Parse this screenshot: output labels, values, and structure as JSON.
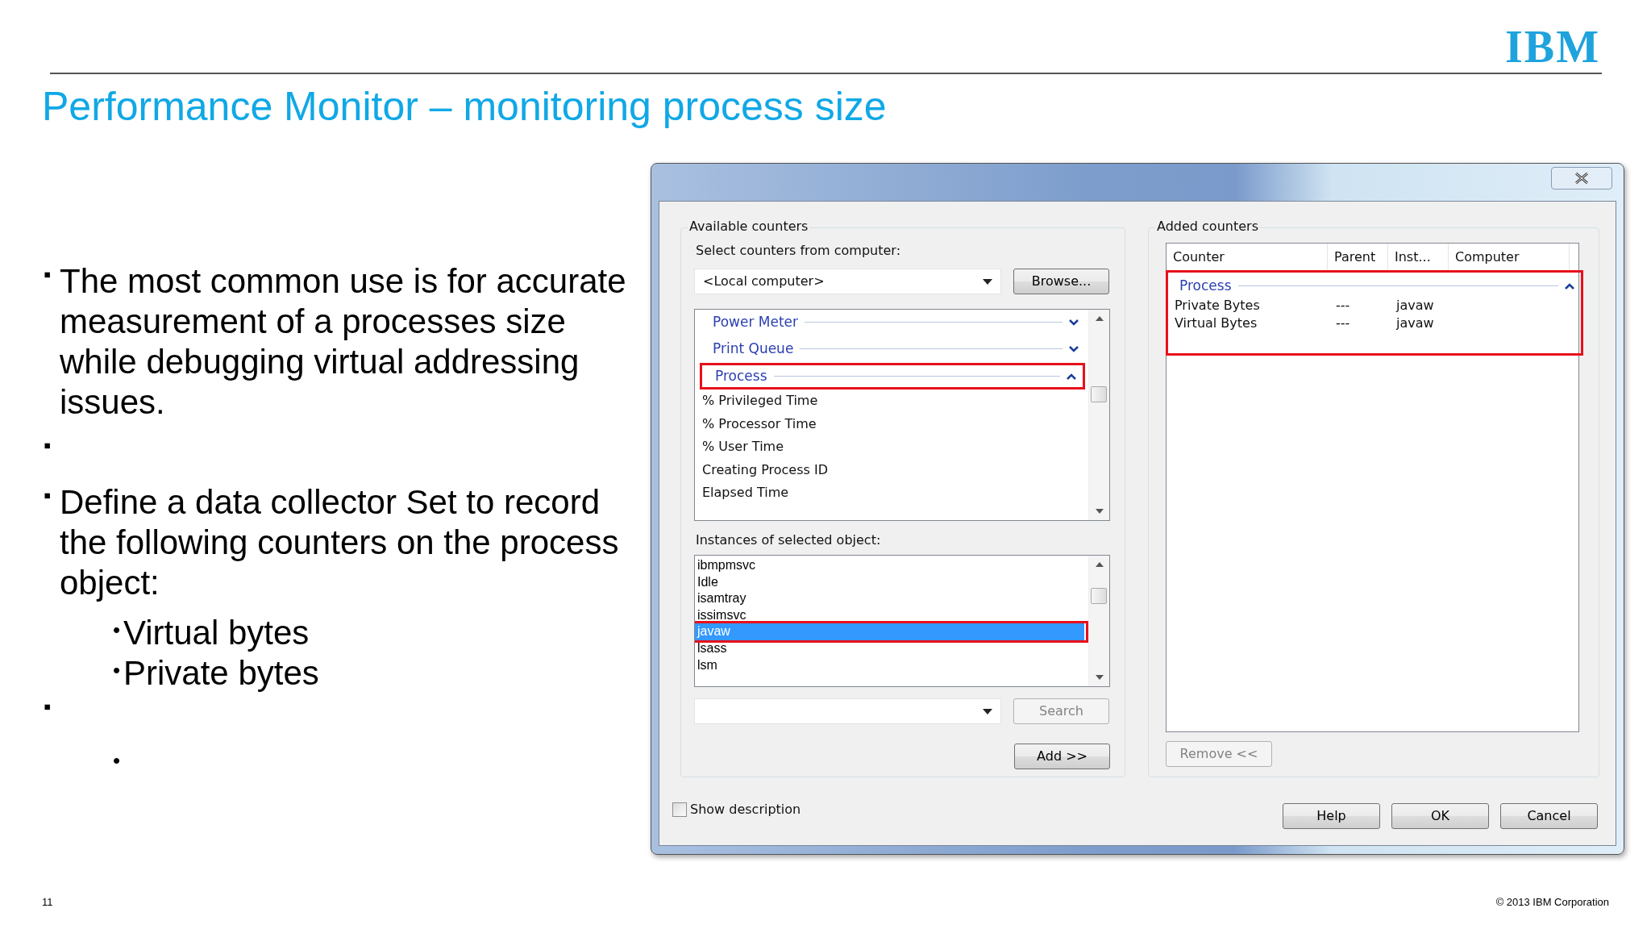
{
  "slide": {
    "logo": "IBM",
    "title": "Performance Monitor – monitoring process size",
    "bullets": [
      {
        "marker": "▪",
        "text": "The most common use is for accurate measurement of a processes size while debugging virtual addressing issues."
      },
      {
        "marker": "▪"
      },
      {
        "marker": "▪",
        "text": "Define a data collector Set to record the following counters on the process object:",
        "children": [
          {
            "marker": "•",
            "text": "Virtual bytes"
          },
          {
            "marker": "•",
            "text": "Private bytes"
          }
        ]
      },
      {
        "marker": "▪",
        "children": [
          {
            "marker": "•"
          }
        ]
      }
    ],
    "page_number": "11",
    "copyright": "© 2013 IBM Corporation"
  },
  "dialog": {
    "available_counters": {
      "label": "Available counters",
      "computer_label": "Select counters from computer:",
      "computer_value": "<Local computer>",
      "browse_button": "Browse...",
      "counters": [
        {
          "kind": "group",
          "label": "Power Meter",
          "expanded": false,
          "highlighted": false
        },
        {
          "kind": "group",
          "label": "Print Queue",
          "expanded": false,
          "highlighted": false
        },
        {
          "kind": "group",
          "label": "Process",
          "expanded": true,
          "highlighted": true
        },
        {
          "kind": "counter",
          "label": "% Privileged Time"
        },
        {
          "kind": "counter",
          "label": "% Processor Time"
        },
        {
          "kind": "counter",
          "label": "% User Time"
        },
        {
          "kind": "counter",
          "label": "Creating Process ID"
        },
        {
          "kind": "counter",
          "label": "Elapsed Time"
        }
      ],
      "instances_label": "Instances of selected object:",
      "instances": [
        {
          "label": "ibmpmsvc",
          "selected": false,
          "highlighted": false
        },
        {
          "label": "Idle",
          "selected": false,
          "highlighted": false
        },
        {
          "label": "isamtray",
          "selected": false,
          "highlighted": false
        },
        {
          "label": "issimsvc",
          "selected": false,
          "highlighted": false
        },
        {
          "label": "javaw",
          "selected": true,
          "highlighted": true
        },
        {
          "label": "lsass",
          "selected": false,
          "highlighted": false
        },
        {
          "label": "lsm",
          "selected": false,
          "highlighted": false
        }
      ],
      "search_button": {
        "label": "Search",
        "disabled": true
      },
      "add_button": {
        "label": "Add >>",
        "disabled": false
      }
    },
    "added_counters": {
      "label": "Added counters",
      "columns": [
        "Counter",
        "Parent",
        "Inst...",
        "Computer"
      ],
      "groups": [
        {
          "label": "Process",
          "expanded": true,
          "highlighted": true,
          "rows": [
            [
              "Private Bytes",
              "---",
              "javaw"
            ],
            [
              "Virtual Bytes",
              "---",
              "javaw"
            ]
          ]
        }
      ],
      "remove_button": {
        "label": "Remove <<",
        "disabled": true
      }
    },
    "show_description": {
      "label": "Show description",
      "checked": false
    },
    "buttons": [
      "Help",
      "OK",
      "Cancel"
    ]
  }
}
